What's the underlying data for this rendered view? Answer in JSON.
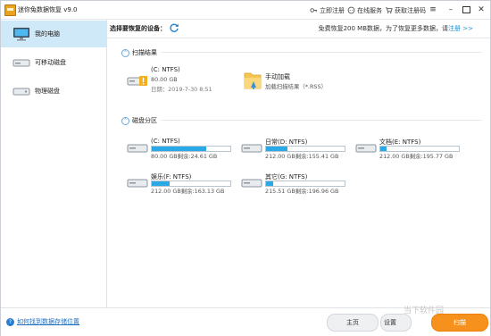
{
  "app": {
    "title": "迷你兔数据恢复 v9.0"
  },
  "toolbar": {
    "register": "立即注册",
    "online_service": "在线服务",
    "get_code": "获取注册码"
  },
  "header": {
    "select_device": "选择要恢复的设备：",
    "quota_text": "免费恢复200 MB数据，为了恢复更多数据，请",
    "register_link": "注册 >>"
  },
  "sidebar": {
    "items": [
      {
        "label": "我的电脑",
        "active": true
      },
      {
        "label": "可移动磁盘",
        "active": false
      },
      {
        "label": "物理磁盘",
        "active": false
      }
    ]
  },
  "scan_results": {
    "title": "扫描结果",
    "items": [
      {
        "name": "(C: NTFS)",
        "size": "80.00 GB",
        "date": "日期：2019-7-30 8:51",
        "icon": "drive-warning-icon"
      },
      {
        "name": "手动加载",
        "size": "加载扫描结果（*.RSS）",
        "date": "",
        "icon": "folder-load-icon"
      }
    ]
  },
  "partitions": {
    "title": "磁盘分区",
    "items": [
      {
        "name": "(C: NTFS)",
        "size": "80.00 GB剩余:24.61 GB",
        "used_fraction": 0.69
      },
      {
        "name": "日常(D: NTFS)",
        "size": "212.00 GB剩余:155.41 GB",
        "used_fraction": 0.27
      },
      {
        "name": "文档(E: NTFS)",
        "size": "212.00 GB剩余:195.77 GB",
        "used_fraction": 0.08
      },
      {
        "name": "娱乐(F: NTFS)",
        "size": "212.00 GB剩余:163.13 GB",
        "used_fraction": 0.23
      },
      {
        "name": "其它(G: NTFS)",
        "size": "215.51 GB剩余:196.96 GB",
        "used_fraction": 0.09
      }
    ]
  },
  "footer": {
    "help_link": "如何找到数据存储位置",
    "home_button": "主页",
    "settings_button": "设置",
    "scan_button": "扫描"
  },
  "watermark": "当下软件园",
  "colors": {
    "accent": "#29a9e6",
    "scan_button": "#f7911d",
    "sidebar_active": "#cfe9f8",
    "link": "#1e8fd6"
  }
}
